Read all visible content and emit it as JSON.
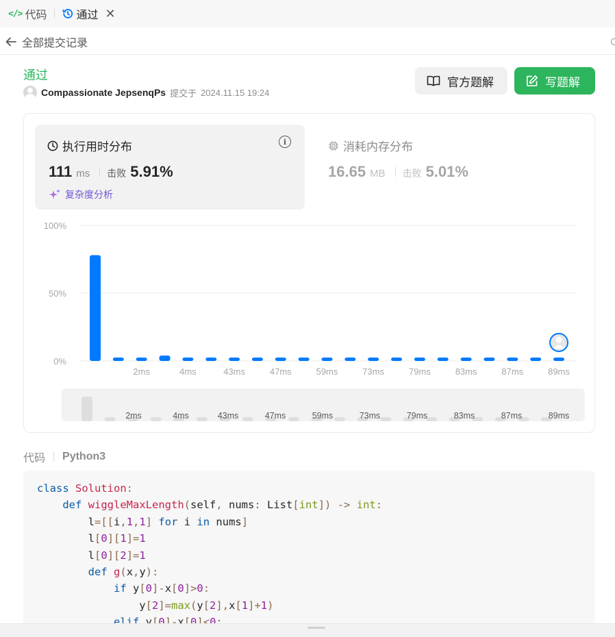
{
  "tabs": [
    {
      "label": "代码",
      "icon": "code-icon",
      "active": false
    },
    {
      "label": "通过",
      "icon": "history-icon",
      "active": true
    }
  ],
  "back": {
    "label": "全部提交记录"
  },
  "submission": {
    "status": "通过",
    "user": "Compassionate JepsenqPs",
    "submitted_prefix": "提交于",
    "submitted_at": "2024.11.15 19:24"
  },
  "buttons": {
    "official": "官方题解",
    "write": "写题解"
  },
  "runtime": {
    "title": "执行用时分布",
    "value": "111",
    "unit": "ms",
    "beat_label": "击败",
    "beat_value": "5.91%",
    "complexity": "复杂度分析"
  },
  "memory": {
    "title": "消耗内存分布",
    "value": "16.65",
    "unit": "MB",
    "beat_label": "击败",
    "beat_value": "5.01%"
  },
  "chart_data": {
    "type": "bar",
    "ylim": [
      0,
      100
    ],
    "yticks": [
      "100%",
      "50%",
      "0%"
    ],
    "x_tick_labels": [
      "2ms",
      "4ms",
      "43ms",
      "47ms",
      "59ms",
      "73ms",
      "79ms",
      "83ms",
      "87ms",
      "89ms"
    ],
    "values": [
      78,
      2.5,
      2.5,
      4,
      2.5,
      2.5,
      2.5,
      2.5,
      2.5,
      2.5,
      2.5,
      2.5,
      2.5,
      2.5,
      2.5,
      2.5,
      2.5,
      2.5,
      2.5,
      2.5,
      2.5
    ],
    "user_bar_index": 20,
    "color": "#007aff",
    "overview_labels": [
      "2ms",
      "4ms",
      "43ms",
      "47ms",
      "59ms",
      "73ms",
      "79ms",
      "83ms",
      "87ms",
      "89ms"
    ]
  },
  "code": {
    "tab_label": "代码",
    "language": "Python3"
  },
  "colors": {
    "accent_green": "#2db55d",
    "bar_blue": "#007aff",
    "complexity_purple": "#7556d6"
  }
}
